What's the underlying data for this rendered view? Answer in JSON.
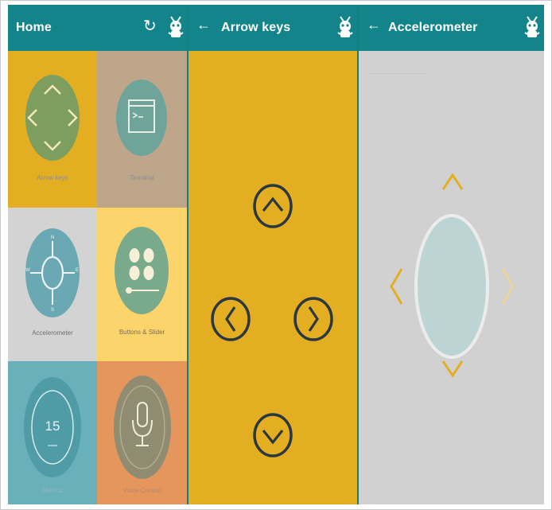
{
  "home": {
    "title": "Home",
    "tiles": [
      {
        "label": "Arrow keys",
        "icon": "arrow-keys-icon",
        "bg": "#e4ae23",
        "circle": "#7d9e5f"
      },
      {
        "label": "Terminal",
        "icon": "terminal-icon",
        "bg": "#bea68a",
        "circle": "#6fa49a"
      },
      {
        "label": "Accelerometer",
        "icon": "compass-icon",
        "bg": "#d3d3d3",
        "circle": "#6aa8b3"
      },
      {
        "label": "Buttons & Slider",
        "icon": "buttons-slider-icon",
        "bg": "#fcd46c",
        "circle": "#7aaa8c"
      },
      {
        "label": "Metrics",
        "icon": "gauge-icon",
        "bg": "#6ab0bb",
        "circle": "#4f9ba6",
        "value": "15"
      },
      {
        "label": "Voice Control",
        "icon": "microphone-icon",
        "bg": "#e5965c",
        "circle": "#8f8c72"
      }
    ]
  },
  "arrow": {
    "title": "Arrow keys"
  },
  "accel": {
    "title": "Accelerometer"
  },
  "colors": {
    "appbar": "#12848a",
    "yellow": "#e4ae23",
    "gray": "#d1d1d1",
    "dark": "#2b3840"
  }
}
